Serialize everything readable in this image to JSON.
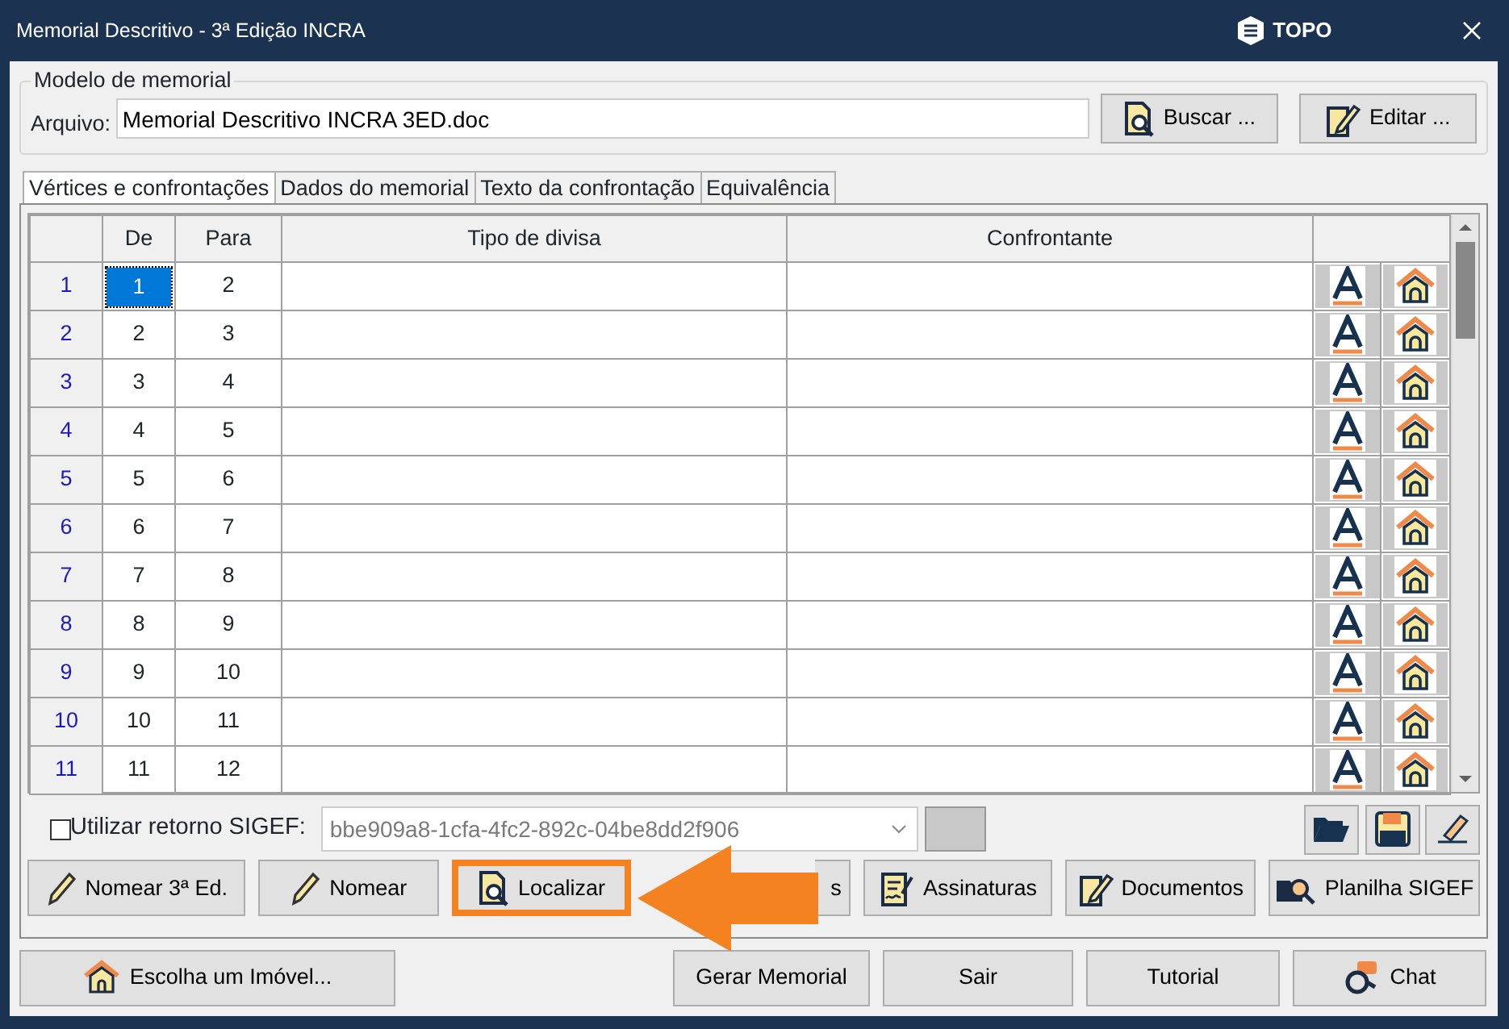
{
  "window": {
    "title": "Memorial Descritivo - 3ª Edição INCRA",
    "brand": "TOPO"
  },
  "model_group": {
    "legend": "Modelo de memorial",
    "file_label": "Arquivo:",
    "file_value": "Memorial Descritivo INCRA 3ED.doc",
    "buttons": [
      {
        "label": "Buscar ..."
      },
      {
        "label": "Editar ..."
      }
    ]
  },
  "tabs": [
    {
      "label": "Vértices e confrontações",
      "selected": true
    },
    {
      "label": "Dados do memorial",
      "selected": false
    },
    {
      "label": "Texto da confrontação",
      "selected": false
    },
    {
      "label": "Equivalência",
      "selected": false
    }
  ],
  "table": {
    "columns": [
      "De",
      "Para",
      "Tipo de divisa",
      "Confrontante"
    ],
    "rows": [
      {
        "number": "1",
        "de": "1",
        "para": "2",
        "selected": true
      },
      {
        "number": "2",
        "de": "2",
        "para": "3",
        "selected": false
      },
      {
        "number": "3",
        "de": "3",
        "para": "4",
        "selected": false
      },
      {
        "number": "4",
        "de": "4",
        "para": "5",
        "selected": false
      },
      {
        "number": "5",
        "de": "5",
        "para": "6",
        "selected": false
      },
      {
        "number": "6",
        "de": "6",
        "para": "7",
        "selected": false
      },
      {
        "number": "7",
        "de": "7",
        "para": "8",
        "selected": false
      },
      {
        "number": "8",
        "de": "8",
        "para": "9",
        "selected": false
      },
      {
        "number": "9",
        "de": "9",
        "para": "10",
        "selected": false
      },
      {
        "number": "10",
        "de": "10",
        "para": "11",
        "selected": false
      },
      {
        "number": "11",
        "de": "11",
        "para": "12",
        "selected": false
      }
    ]
  },
  "sigef": {
    "label": "Utilizar retorno SIGEF:",
    "checked": false,
    "value": "bbe909a8-1cfa-4fc2-892c-04be8dd2f906"
  },
  "action_buttons": [
    {
      "label": "Nomear 3ª Ed.",
      "highlighted": false
    },
    {
      "label": "Nomear",
      "highlighted": false
    },
    {
      "label": "Localizar",
      "highlighted": true
    },
    {
      "label": "s",
      "highlighted": false
    },
    {
      "label": "Assinaturas",
      "highlighted": false
    },
    {
      "label": "Documentos",
      "highlighted": false
    },
    {
      "label": "Planilha SIGEF",
      "highlighted": false
    }
  ],
  "footer_buttons": [
    {
      "label": "Escolha um Imóvel..."
    },
    {
      "label": "Gerar Memorial"
    },
    {
      "label": "Sair"
    },
    {
      "label": "Tutorial"
    },
    {
      "label": "Chat"
    }
  ]
}
